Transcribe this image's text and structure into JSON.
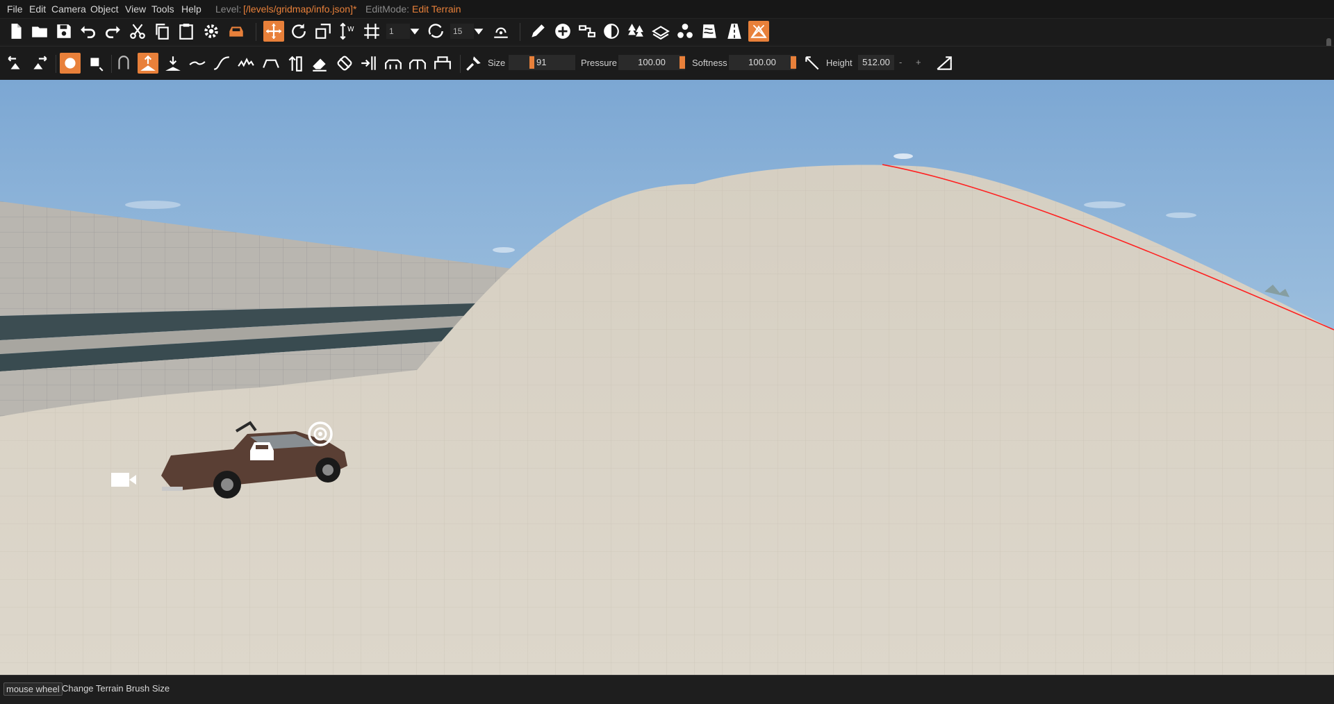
{
  "menu": [
    "File",
    "Edit",
    "Camera",
    "Object",
    "View",
    "Tools",
    "Help"
  ],
  "level_label": "Level:",
  "level_path": "[/levels/gridmap/info.json]*",
  "editmode_label": "EditMode:",
  "editmode_value": "Edit Terrain",
  "toolbar1": {
    "snap_count": "1",
    "rotate_snap": "15",
    "icons": [
      "new-file-icon",
      "open-folder-icon",
      "save-icon",
      "undo-icon",
      "redo-icon",
      "cut-icon",
      "copy-icon",
      "paste-icon",
      "settings-gear-icon",
      "vehicle-icon",
      "translate-icon",
      "rotate-icon",
      "scale-icon",
      "snap-height-icon",
      "grid-snap-icon",
      "rotate-snap-icon",
      "terrain-snap-icon",
      "pencil-icon",
      "add-object-icon",
      "road-spline-icon",
      "decal-icon",
      "forest-icon",
      "terrain-material-icon",
      "meshes-icon",
      "river-icon",
      "road-icon",
      "mesh-road-icon",
      "terrain-editor-icon"
    ]
  },
  "toolbar2": {
    "size_label": "Size",
    "size_value": "91",
    "pressure_label": "Pressure",
    "pressure_value": "100.00",
    "softness_label": "Softness",
    "softness_value": "100.00",
    "height_label": "Height",
    "height_value": "512.00",
    "minus": "-",
    "plus": "+"
  },
  "statusbar": {
    "key": "mouse wheel",
    "hint": "Change Terrain Brush Size"
  },
  "colors": {
    "accent": "#e8803a",
    "sky_top": "#7ca7d3",
    "terrain": "#d8d2c6",
    "vehicle": "#5a3f34"
  }
}
